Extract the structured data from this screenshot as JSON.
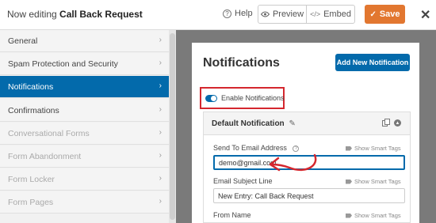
{
  "topbar": {
    "title_prefix": "Now editing",
    "form_name": "Call Back Request",
    "help_label": "Help",
    "preview_label": "Preview",
    "embed_label": "Embed",
    "save_label": "Save"
  },
  "sidebar": {
    "items": [
      {
        "label": "General",
        "state": "normal"
      },
      {
        "label": "Spam Protection and Security",
        "state": "normal"
      },
      {
        "label": "Notifications",
        "state": "active"
      },
      {
        "label": "Confirmations",
        "state": "normal"
      },
      {
        "label": "Conversational Forms",
        "state": "muted"
      },
      {
        "label": "Form Abandonment",
        "state": "muted"
      },
      {
        "label": "Form Locker",
        "state": "muted"
      },
      {
        "label": "Form Pages",
        "state": "muted"
      }
    ]
  },
  "main": {
    "heading": "Notifications",
    "add_button": "Add New Notification",
    "enable_label": "Enable Notifications",
    "enable_on": true,
    "notification": {
      "title": "Default Notification",
      "fields": [
        {
          "label": "Send To Email Address",
          "value": "demo@gmail.com",
          "smart_tags": "Show Smart Tags"
        },
        {
          "label": "Email Subject Line",
          "value": "New Entry: Call Back Request",
          "smart_tags": "Show Smart Tags"
        },
        {
          "label": "From Name",
          "value": "",
          "smart_tags": "Show Smart Tags"
        }
      ]
    }
  },
  "colors": {
    "accent_blue": "#036aab",
    "save_orange": "#e27730",
    "highlight_red": "#d4272e"
  }
}
